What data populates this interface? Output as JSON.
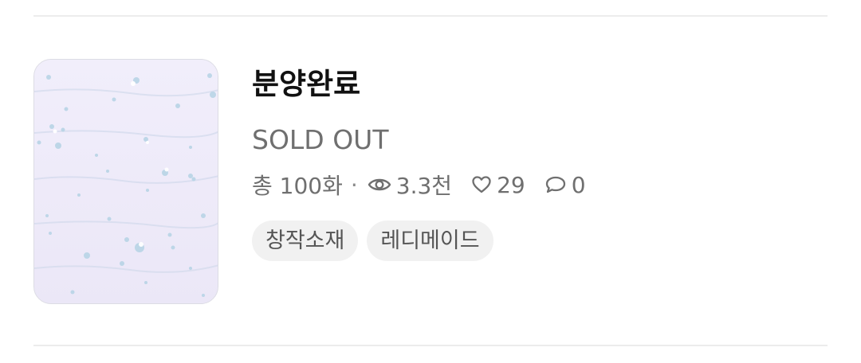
{
  "item": {
    "title": "분양완료",
    "subtitle": "SOLD OUT",
    "episodes_label": "총 100화",
    "separator": "·",
    "views": "3.3천",
    "likes": "29",
    "comments": "0",
    "tags": [
      "창작소재",
      "레디메이드"
    ],
    "cover_icon": "cover-image"
  },
  "colors": {
    "title": "#111111",
    "secondary_text": "#6f6f6f",
    "tag_bg": "#f1f1f1",
    "tag_text": "#555555",
    "divider": "#ececec",
    "cover_bg": "#eeeaf8",
    "cover_accent": "#9cc4dc"
  }
}
